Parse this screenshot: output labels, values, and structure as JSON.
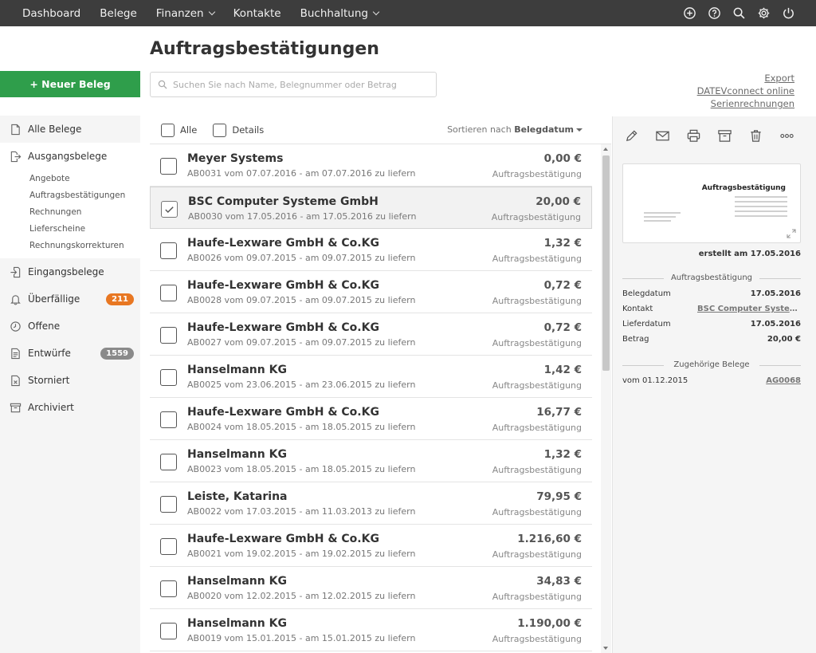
{
  "topnav": {
    "items": [
      {
        "label": "Dashboard",
        "dropdown": false
      },
      {
        "label": "Belege",
        "dropdown": false
      },
      {
        "label": "Finanzen",
        "dropdown": true
      },
      {
        "label": "Kontakte",
        "dropdown": false
      },
      {
        "label": "Buchhaltung",
        "dropdown": true
      }
    ],
    "icons": [
      "plus-circle-icon",
      "help-icon",
      "search-icon",
      "gear-icon",
      "power-icon"
    ]
  },
  "sidebar": {
    "new_button": "+ Neuer Beleg",
    "items": [
      {
        "label": "Alle Belege",
        "icon": "document-icon"
      },
      {
        "label": "Ausgangsbelege",
        "icon": "document-out-icon"
      },
      {
        "label": "Eingangsbelege",
        "icon": "document-in-icon"
      },
      {
        "label": "Überfällige",
        "icon": "bell-icon",
        "badge": "211"
      },
      {
        "label": "Offene",
        "icon": "clock-icon"
      },
      {
        "label": "Entwürfe",
        "icon": "draft-icon",
        "badge": "1559"
      },
      {
        "label": "Storniert",
        "icon": "cancelled-icon"
      },
      {
        "label": "Archiviert",
        "icon": "archive-icon"
      }
    ],
    "subitems": [
      "Angebote",
      "Auftragsbestätigungen",
      "Rechnungen",
      "Lieferscheine",
      "Rechnungskorrekturen"
    ]
  },
  "main": {
    "title": "Auftragsbestätigungen",
    "search_placeholder": "Suchen Sie nach Name, Belegnummer oder Betrag",
    "links": [
      "Export",
      "DATEVconnect online",
      "Serienrechnungen"
    ],
    "list_header": {
      "all_label": "Alle",
      "details_label": "Details",
      "sort_prefix": "Sortieren nach",
      "sort_field": "Belegdatum"
    },
    "rows": [
      {
        "name": "Meyer Systems",
        "sub": "AB0031 vom 07.07.2016 - am 07.07.2016 zu liefern",
        "amount": "0,00 €",
        "type": "Auftragsbestätigung",
        "selected": false
      },
      {
        "name": "BSC Computer Systeme GmbH",
        "sub": "AB0030 vom 17.05.2016 - am 17.05.2016 zu liefern",
        "amount": "20,00 €",
        "type": "Auftragsbestätigung",
        "selected": true
      },
      {
        "name": "Haufe-Lexware GmbH & Co.KG",
        "sub": "AB0026 vom 09.07.2015 - am 09.07.2015 zu liefern",
        "amount": "1,32 €",
        "type": "Auftragsbestätigung",
        "selected": false
      },
      {
        "name": "Haufe-Lexware GmbH & Co.KG",
        "sub": "AB0028 vom 09.07.2015 - am 09.07.2015 zu liefern",
        "amount": "0,72 €",
        "type": "Auftragsbestätigung",
        "selected": false
      },
      {
        "name": "Haufe-Lexware GmbH & Co.KG",
        "sub": "AB0027 vom 09.07.2015 - am 09.07.2015 zu liefern",
        "amount": "0,72 €",
        "type": "Auftragsbestätigung",
        "selected": false
      },
      {
        "name": "Hanselmann KG",
        "sub": "AB0025 vom 23.06.2015 - am 23.06.2015 zu liefern",
        "amount": "1,42 €",
        "type": "Auftragsbestätigung",
        "selected": false
      },
      {
        "name": "Haufe-Lexware GmbH & Co.KG",
        "sub": "AB0024 vom 18.05.2015 - am 18.05.2015 zu liefern",
        "amount": "16,77 €",
        "type": "Auftragsbestätigung",
        "selected": false
      },
      {
        "name": "Hanselmann KG",
        "sub": "AB0023 vom 18.05.2015 - am 18.05.2015 zu liefern",
        "amount": "1,32 €",
        "type": "Auftragsbestätigung",
        "selected": false
      },
      {
        "name": "Leiste, Katarina",
        "sub": "AB0022 vom 17.03.2015 - am 11.03.2013 zu liefern",
        "amount": "79,95 €",
        "type": "Auftragsbestätigung",
        "selected": false
      },
      {
        "name": "Haufe-Lexware GmbH & Co.KG",
        "sub": "AB0021 vom 19.02.2015 - am 19.02.2015 zu liefern",
        "amount": "1.216,60 €",
        "type": "Auftragsbestätigung",
        "selected": false
      },
      {
        "name": "Hanselmann KG",
        "sub": "AB0020 vom 12.02.2015 - am 12.02.2015 zu liefern",
        "amount": "34,83 €",
        "type": "Auftragsbestätigung",
        "selected": false
      },
      {
        "name": "Hanselmann KG",
        "sub": "AB0019 vom 15.01.2015 - am 15.01.2015 zu liefern",
        "amount": "1.190,00 €",
        "type": "Auftragsbestätigung",
        "selected": false
      }
    ]
  },
  "detail": {
    "action_icons": [
      "pencil-icon",
      "mail-icon",
      "print-icon",
      "archive-icon",
      "trash-icon",
      "more-icon"
    ],
    "preview_title": "Auftragsbestätigung",
    "created": "erstellt am 17.05.2016",
    "section1": "Auftragsbestätigung",
    "fields": [
      {
        "label": "Belegdatum",
        "value": "17.05.2016",
        "link": false
      },
      {
        "label": "Kontakt",
        "value": "BSC Computer Systeme GmbH",
        "link": true
      },
      {
        "label": "Lieferdatum",
        "value": "17.05.2016",
        "link": false
      },
      {
        "label": "Betrag",
        "value": "20,00 €",
        "link": false
      }
    ],
    "section2": "Zugehörige Belege",
    "related": {
      "label": "vom 01.12.2015",
      "value": "AG0068"
    }
  },
  "colors": {
    "topbar": "#3d3d3d",
    "primary_green": "#2f9e4b",
    "badge_orange": "#e87722",
    "badge_gray": "#8a8a8a"
  }
}
